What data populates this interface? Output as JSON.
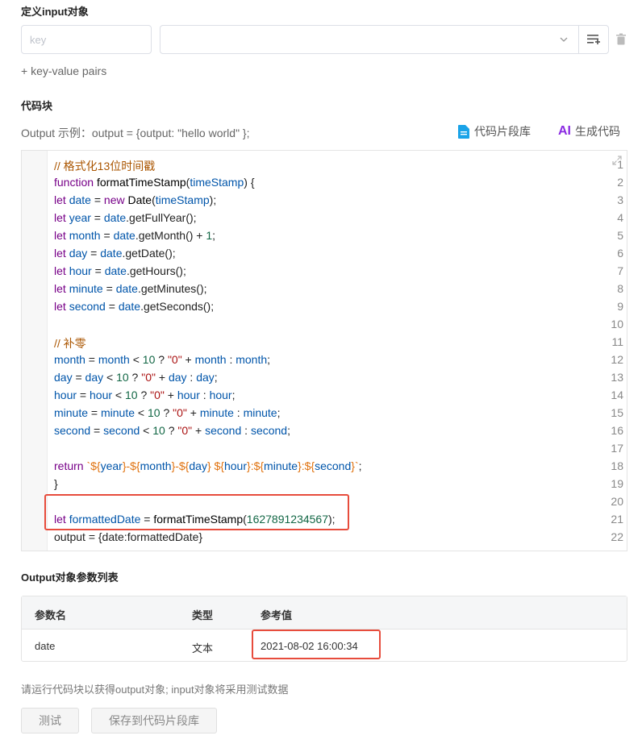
{
  "input_section": {
    "title": "定义input对象",
    "key_placeholder": "key",
    "add_pairs_label": "+ key-value pairs"
  },
  "code_section": {
    "title": "代码块",
    "output_example": "Output 示例：output = {output: \"hello world\" };",
    "snippet_library_label": "代码片段库",
    "ai_badge": "AI",
    "ai_generate_label": "生成代码",
    "line_numbers": [
      "1",
      "2",
      "3",
      "4",
      "5",
      "6",
      "7",
      "8",
      "9",
      "10",
      "11",
      "12",
      "13",
      "14",
      "15",
      "16",
      "17",
      "18",
      "19",
      "20",
      "21",
      "22"
    ]
  },
  "output_section": {
    "title": "Output对象参数列表",
    "columns": [
      "参数名",
      "类型",
      "参考值"
    ],
    "rows": [
      {
        "name": "date",
        "type": "文本",
        "value": "2021-08-02 16:00:34"
      }
    ]
  },
  "footer": {
    "hint": "请运行代码块以获得output对象; input对象将采用测试数据",
    "test_button": "测试",
    "save_button": "保存到代码片段库"
  },
  "colors": {
    "highlight_border": "#e74c3c",
    "ai_accent": "#8a2be2",
    "doc_icon": "#1aa3e8"
  }
}
